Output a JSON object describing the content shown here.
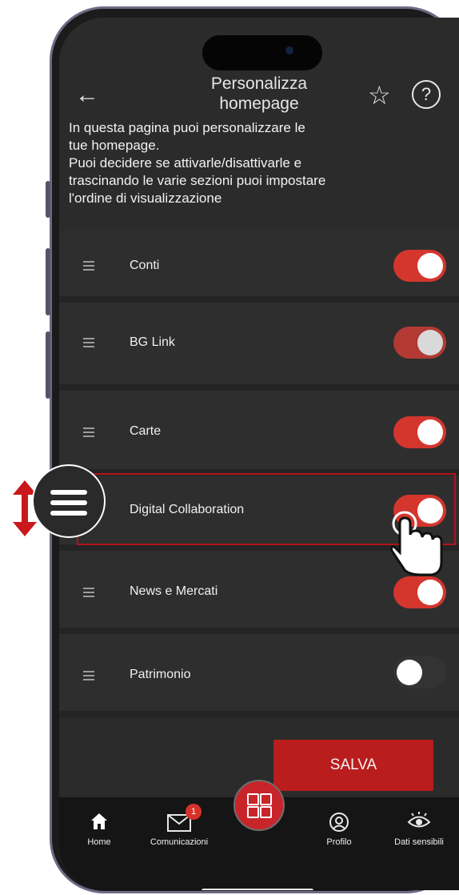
{
  "header": {
    "title": "Personalizza homepage",
    "back_icon": "arrow-left-icon",
    "star_icon": "star-outline-icon",
    "help_icon": "question-circle-icon",
    "help_glyph": "?"
  },
  "intro_text": "In questa pagina puoi personalizzare le\ntue homepage.\nPuoi decidere se attivarle/disattivarle e\ntrascinando le varie sezioni puoi impostare\nl'ordine di visualizzazione",
  "sections": [
    {
      "label": "Conti",
      "enabled": true
    },
    {
      "label": "BG Link",
      "enabled": true,
      "state": "disabled-on"
    },
    {
      "label": "Carte",
      "enabled": true
    },
    {
      "label": "Digital Collaboration",
      "enabled": true,
      "highlighted": true
    },
    {
      "label": "News e Mercati",
      "enabled": true
    },
    {
      "label": "Patrimonio",
      "enabled": false
    }
  ],
  "save_button": "SALVA",
  "bottom_nav": {
    "home": "Home",
    "comunicazioni": "Comunicazioni",
    "comunicazioni_badge": "1",
    "profilo": "Profilo",
    "dati_sensibili": "Dati sensibili"
  },
  "colors": {
    "accent": "#d4362e",
    "background": "#2b2b2b",
    "nav_background": "#151515"
  }
}
